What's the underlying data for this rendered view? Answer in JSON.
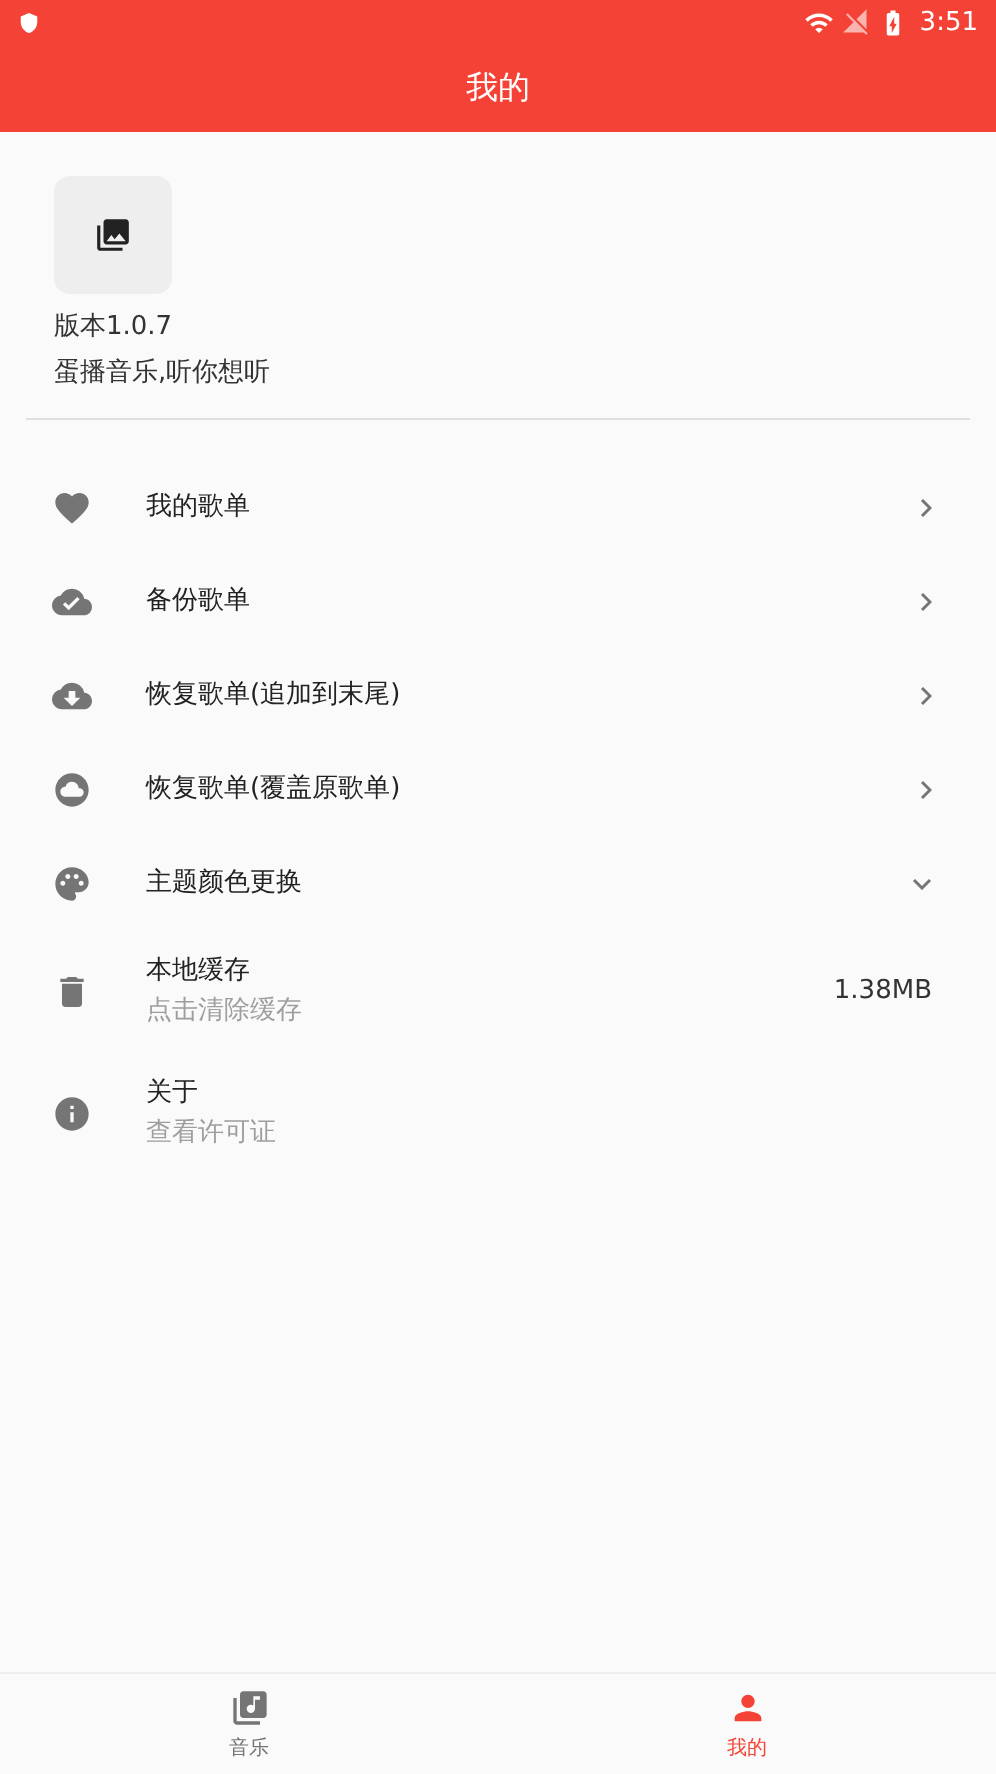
{
  "status_bar": {
    "time": "3:51"
  },
  "app_bar": {
    "title": "我的"
  },
  "profile": {
    "version": "版本1.0.7",
    "slogan": "蛋播音乐,听你想听"
  },
  "menu": [
    {
      "title": "我的歌单",
      "kind": "link"
    },
    {
      "title": "备份歌单",
      "kind": "link"
    },
    {
      "title": "恢复歌单(追加到末尾)",
      "kind": "link"
    },
    {
      "title": "恢复歌单(覆盖原歌单)",
      "kind": "link"
    },
    {
      "title": "主题颜色更换",
      "kind": "expandable"
    },
    {
      "title": "本地缓存",
      "subtitle": "点击清除缓存",
      "kind": "valued",
      "value": "1.38MB"
    },
    {
      "title": "关于",
      "subtitle": "查看许可证",
      "kind": "plain"
    }
  ],
  "bottom_nav": [
    {
      "label": "音乐",
      "selected": false
    },
    {
      "label": "我的",
      "selected": true
    }
  ]
}
